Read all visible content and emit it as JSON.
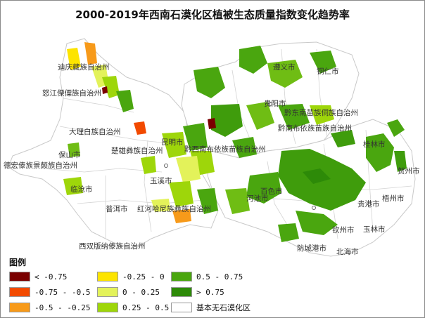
{
  "map": {
    "title": "2000-2019年西南石漠化区植被生态质量指数变化趋势率",
    "legend_title": "图例",
    "legend": [
      {
        "label": "< -0.75",
        "color": "#7a0000"
      },
      {
        "label": "-0.75 - -0.5",
        "color": "#f24a00"
      },
      {
        "label": "-0.5 - -0.25",
        "color": "#f79a1a"
      },
      {
        "label": "-0.25 - 0",
        "color": "#fde400"
      },
      {
        "label": "0 - 0.25",
        "color": "#e3f25a"
      },
      {
        "label": "0.25 - 0.5",
        "color": "#9ed60a"
      },
      {
        "label": "0.5 - 0.75",
        "color": "#4aa60f"
      },
      {
        "label": "> 0.75",
        "color": "#2d8a08"
      },
      {
        "label": "基本无石漠化区",
        "color": "#ffffff"
      }
    ],
    "region_labels": [
      "迪庆藏族自治州",
      "怒江傈僳族自治州",
      "大理白族自治州",
      "保山市",
      "德宏傣族景颇族自治州",
      "临沧市",
      "楚雄彝族自治州",
      "昆明市",
      "玉溪市",
      "普洱市",
      "红河哈尼族彝族自治州",
      "西双版纳傣族自治州",
      "遵义市",
      "铜仁市",
      "贵阳市",
      "黔东南苗族侗族自治州",
      "黔南布依族苗族自治州",
      "黔西南布依族苗族自治州",
      "百色市",
      "河池市",
      "桂林市",
      "贺州市",
      "梧州市",
      "贵港市",
      "玉林市",
      "钦州市",
      "防城港市",
      "北海市"
    ]
  }
}
